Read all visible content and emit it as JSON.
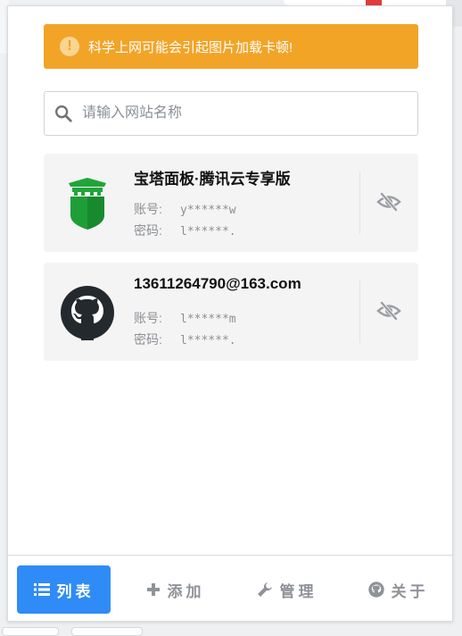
{
  "notice": {
    "text": "科学上网可能会引起图片加载卡顿!"
  },
  "search": {
    "placeholder": "请输入网站名称",
    "value": ""
  },
  "accounts": [
    {
      "title": "宝塔面板·腾讯云专享版",
      "username_label": "账号:",
      "username": "y******w",
      "password_label": "密码:",
      "password": "l******.",
      "logo": "bt-panel-logo"
    },
    {
      "title": "13611264790@163.com",
      "username_label": "账号:",
      "username": "l******m",
      "password_label": "密码:",
      "password": "l******.",
      "logo": "github-logo"
    }
  ],
  "nav": {
    "items": [
      {
        "label": "列表",
        "icon": "list-icon",
        "active": true
      },
      {
        "label": "添加",
        "icon": "plus-icon",
        "active": false
      },
      {
        "label": "管理",
        "icon": "wrench-icon",
        "active": false
      },
      {
        "label": "关于",
        "icon": "github-icon",
        "active": false
      }
    ]
  },
  "colors": {
    "accent": "#2f8cf6",
    "warning": "#f2a427",
    "card_bg": "#f4f4f5",
    "bt_green": "#20a53a"
  }
}
